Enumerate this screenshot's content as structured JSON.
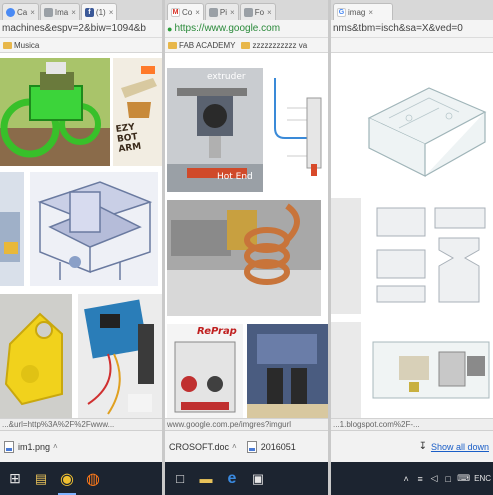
{
  "windows": [
    {
      "tabs": [
        {
          "label": "Ca",
          "favicon": "chrome-icon",
          "color": "#4a8af4"
        },
        {
          "label": "Ima",
          "favicon": "page-icon",
          "color": "#9aa0a6"
        },
        {
          "label": "(1)",
          "favicon": "facebook-icon",
          "color": "#3b5998"
        }
      ],
      "url": "machines&espv=2&biw=1094&b",
      "bookmarks": [
        {
          "label": "Musica"
        }
      ],
      "status": "...&url=http%3A%2F%2Fwww...",
      "download": {
        "file": "im1.png",
        "sep": "˄"
      },
      "taskbar": [
        {
          "name": "windows-start-icon",
          "glyph": "⊞",
          "running": false
        },
        {
          "name": "file-explorer-icon",
          "glyph": "▤",
          "running": false
        },
        {
          "name": "chrome-taskbar-icon",
          "glyph": "◉",
          "running": true
        },
        {
          "name": "firefox-taskbar-icon",
          "glyph": "◍",
          "running": false
        }
      ]
    },
    {
      "tabs": [
        {
          "label": "Co",
          "favicon": "gmail-icon",
          "color": "#d93025"
        },
        {
          "label": "Pi",
          "favicon": "page-icon",
          "color": "#9aa0a6"
        },
        {
          "label": "Fo",
          "favicon": "page-icon",
          "color": "#9aa0a6"
        }
      ],
      "url": "https://www.google.com",
      "bookmarks": [
        {
          "label": "FAB ACADEMY"
        },
        {
          "label": "zzzzzzzzzzz va"
        }
      ],
      "status": "www.google.com.pe/imgres?imgurl",
      "download": {
        "file": "CROSOFT.doc",
        "sep": "˄",
        "extra": "2016051"
      },
      "taskbar": [
        {
          "name": "task-view-icon",
          "glyph": "□",
          "running": false
        },
        {
          "name": "folder-taskbar-icon",
          "glyph": "▬",
          "running": false
        },
        {
          "name": "edge-taskbar-icon",
          "glyph": "e",
          "running": false
        },
        {
          "name": "window-taskbar-icon",
          "glyph": "▣",
          "running": false
        }
      ]
    },
    {
      "tabs": [
        {
          "label": "imag",
          "favicon": "google-icon",
          "color": "#4285f4"
        }
      ],
      "url": "nms&tbm=isch&sa=X&ved=0",
      "bookmarks": [],
      "status": "...1.blogspot.com%2F-...",
      "download": {
        "file": "",
        "sep": "",
        "showall": "Show all down"
      },
      "taskbar": [
        {
          "name": "chevron-up-icon",
          "glyph": "˄",
          "running": false
        },
        {
          "name": "network-icon",
          "glyph": "≡",
          "running": false
        },
        {
          "name": "volume-icon",
          "glyph": "◁",
          "running": false
        },
        {
          "name": "notification-icon",
          "glyph": "□",
          "running": false
        },
        {
          "name": "keyboard-icon",
          "glyph": "⌨",
          "running": false
        },
        {
          "name": "language-indicator",
          "glyph": "ENC",
          "running": false
        }
      ]
    }
  ],
  "thumbnails": [
    {
      "name": "robot-vehicle-thumbnail",
      "caption": ""
    },
    {
      "name": "ezy-bot-arm-thumbnail",
      "caption": "EZY BOT ARM"
    },
    {
      "name": "cad-assembly-thumbnail",
      "caption": ""
    },
    {
      "name": "printed-bracket-thumbnail",
      "caption": ""
    },
    {
      "name": "arduino-board-thumbnail",
      "caption": ""
    },
    {
      "name": "printer-extruder-thumbnail",
      "caption": "extruder"
    },
    {
      "name": "hot-end-label",
      "caption": "Hot End"
    },
    {
      "name": "filament-diagram-thumbnail",
      "caption": ""
    },
    {
      "name": "copper-coil-thumbnail",
      "caption": ""
    },
    {
      "name": "reprap-box-thumbnail",
      "caption": "RePrap"
    },
    {
      "name": "dual-extruder-thumbnail",
      "caption": ""
    },
    {
      "name": "acrylic-case-thumbnail",
      "caption": ""
    },
    {
      "name": "acrylic-parts-thumbnail",
      "caption": ""
    },
    {
      "name": "acrylic-pi-case-thumbnail",
      "caption": ""
    }
  ]
}
